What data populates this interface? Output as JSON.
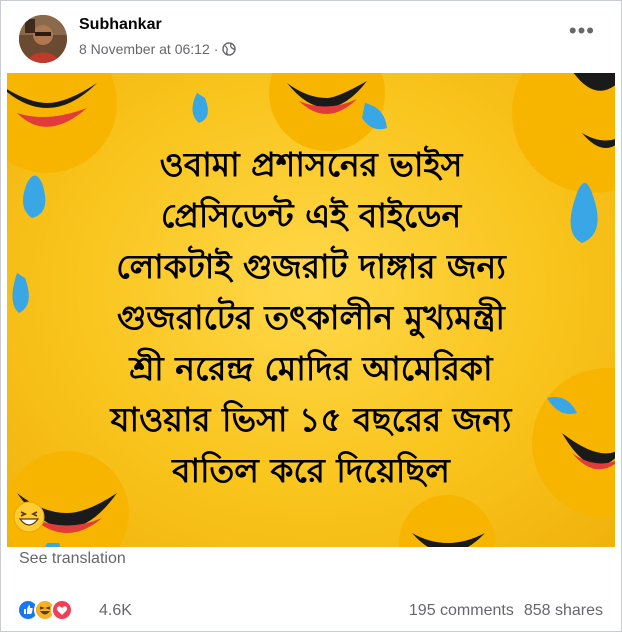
{
  "post": {
    "author": "Subhankar",
    "timestamp": "8 November at 06:12",
    "separator": "·",
    "audience_icon": "globe-icon",
    "more_icon": "more-options-icon"
  },
  "image_text": {
    "lines": [
      "ওবামা প্রশাসনের ভাইস",
      "প্রেসিডেন্ট এই বাইডেন",
      "লোকটাই গুজরাট দাঙ্গার জন্য",
      "গুজরাটের তৎকালীন মুখ্যমন্ত্রী",
      "শ্রী নরেন্দ্র মোদির আমেরিকা",
      "যাওয়ার ভিসা ১৫ বছরের জন্য",
      "বাতিল করে দিয়েছিল"
    ],
    "emoji": "grinning-squinting-face-icon"
  },
  "see_translation": "See translation",
  "engagement": {
    "reaction_icons": [
      "like-icon",
      "haha-icon",
      "love-icon"
    ],
    "reaction_count": "4.6K",
    "comments": "195 comments",
    "shares": "858 shares"
  },
  "colors": {
    "background_yellow": "#f9c51d",
    "meta_gray": "#65676b",
    "like_blue": "#1877f2",
    "love_red": "#f33e58"
  }
}
